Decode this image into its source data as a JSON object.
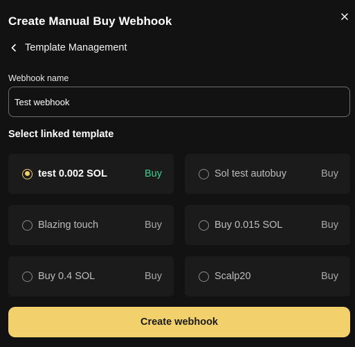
{
  "dialog": {
    "title": "Create Manual Buy Webhook"
  },
  "breadcrumb": {
    "back_label": "Template Management"
  },
  "form": {
    "name_label": "Webhook name",
    "name_value": "Test webhook",
    "linked_template_title": "Select linked template"
  },
  "templates": [
    {
      "name": "test 0.002 SOL",
      "type": "Buy",
      "selected": true
    },
    {
      "name": "Sol test autobuy",
      "type": "Buy",
      "selected": false
    },
    {
      "name": "Blazing touch",
      "type": "Buy",
      "selected": false
    },
    {
      "name": "Buy 0.015 SOL",
      "type": "Buy",
      "selected": false
    },
    {
      "name": "Buy 0.4 SOL",
      "type": "Buy",
      "selected": false
    },
    {
      "name": "Scalp20",
      "type": "Buy",
      "selected": false
    }
  ],
  "actions": {
    "create_label": "Create webhook"
  },
  "icons": {
    "close": "close-icon",
    "back": "chevron-left-icon"
  },
  "colors": {
    "background": "#121212",
    "card": "#1b1b1b",
    "accent": "#f2d16d",
    "buy_selected": "#3fcf8e"
  }
}
